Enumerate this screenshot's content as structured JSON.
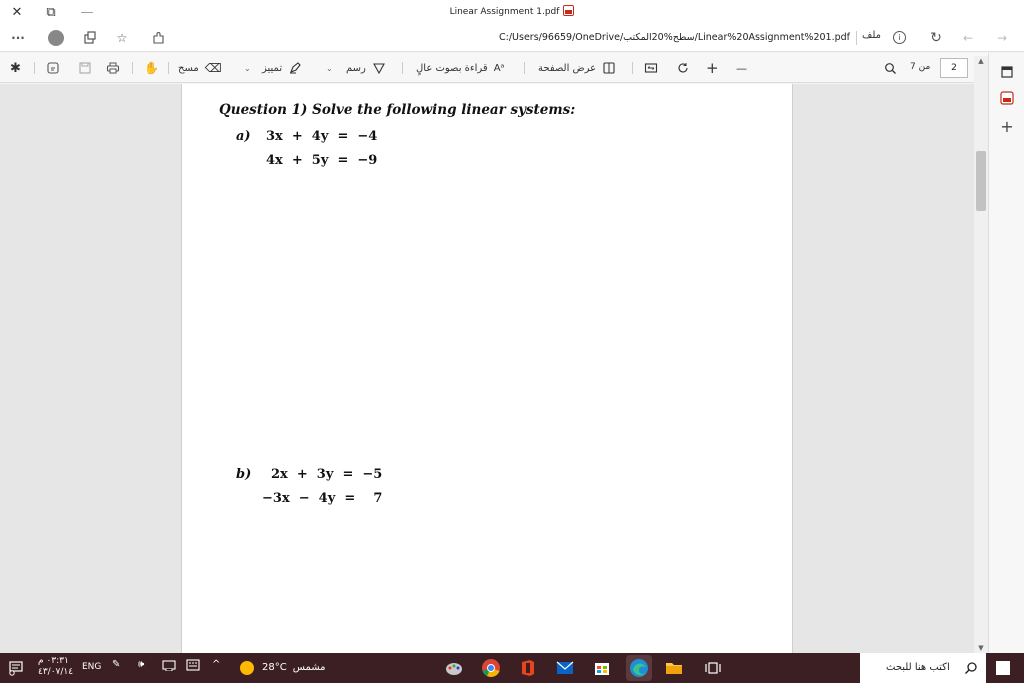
{
  "titlebar": {
    "title": "Linear Assignment 1.pdf",
    "close_glyph": "✕",
    "restore_glyph": "⧉",
    "minimize_glyph": "—"
  },
  "addressbar": {
    "url": "C:/Users/96659/OneDrive/سطح%20المكتب/Linear%20Assignment%201.pdf",
    "file_label": "ملف",
    "more_glyph": "···"
  },
  "pdf_toolbar": {
    "erase_label": "مسح",
    "highlight_label": "تمييز",
    "draw_label": "رسم",
    "read_aloud_label": "قراءة بصوت عالٍ",
    "page_view_label": "عرض الصفحة",
    "zoom_in_glyph": "+",
    "zoom_out_glyph": "—",
    "page_number": "2",
    "page_total": "من 7"
  },
  "document": {
    "question_title": "Question 1) Solve the following linear systems:",
    "part_a": {
      "label": "a)",
      "eq1": "3x  +  4y  =  −4",
      "eq2": "4x  +  5y  =  −9"
    },
    "part_b": {
      "label": "b)",
      "eq1": "2x  +  3y  =  −5",
      "eq2": "−3x  −  4y  =    7"
    }
  },
  "taskbar": {
    "time": "٠٣:٣١ م",
    "date": "٤٣/٠٧/١٤",
    "language": "ENG",
    "temperature": "28°C",
    "weather_label": "مشمس",
    "search_placeholder": "اكتب هنا للبحث"
  },
  "colors": {
    "taskbar_bg": "#3c1f22",
    "pdf_red": "#c42b1c",
    "weather_sun": "#ffb900"
  }
}
